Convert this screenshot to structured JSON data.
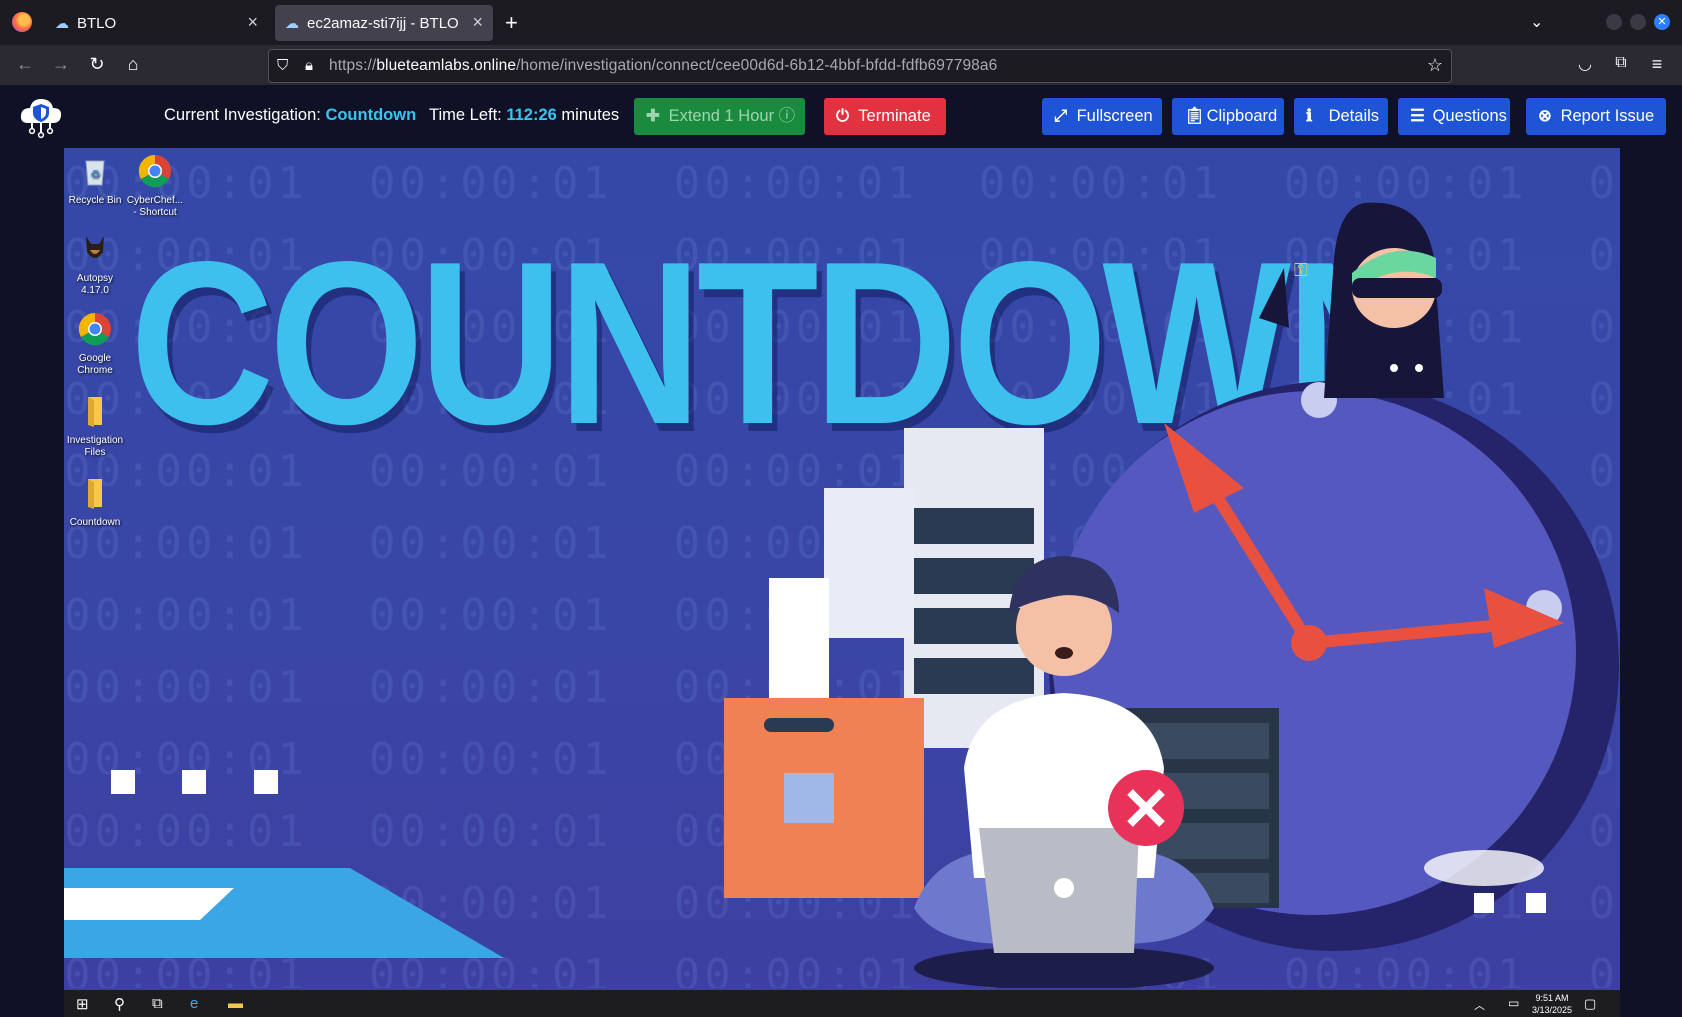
{
  "browser": {
    "tabs": [
      {
        "label": "BTLO",
        "active": false
      },
      {
        "label": "ec2amaz-sti7ijj - BTLO",
        "active": true
      }
    ],
    "url": {
      "scheme": "https://",
      "domain": "blueteamlabs.online",
      "path": "/home/investigation/connect/cee00d6d-6b12-4bbf-bfdd-fdfb697798a6"
    }
  },
  "header": {
    "investigation_label": "Current Investigation:",
    "investigation_name": "Countdown",
    "time_label": "Time Left:",
    "time_value": "112:26",
    "time_unit": "minutes",
    "buttons": {
      "extend": "Extend 1 Hour",
      "terminate": "Terminate",
      "fullscreen": "Fullscreen",
      "clipboard": "Clipboard",
      "details": "Details",
      "questions": "Questions",
      "report": "Report Issue"
    }
  },
  "desktop": {
    "wallpaper_title": "COUNTDOWN",
    "icons": [
      {
        "line1": "Recycle Bin",
        "line2": ""
      },
      {
        "line1": "CyberChef...",
        "line2": "- Shortcut"
      },
      {
        "line1": "Autopsy",
        "line2": "4.17.0"
      },
      {
        "line1": "Google",
        "line2": "Chrome"
      },
      {
        "line1": "Investigation",
        "line2": "Files"
      },
      {
        "line1": "Countdown",
        "line2": ""
      }
    ],
    "taskbar": {
      "time": "9:51 AM",
      "date": "3/13/2025"
    }
  },
  "colors": {
    "accent": "#39c4f0",
    "extend_green": "#198a3e",
    "terminate_red": "#e3323f",
    "button_blue": "#1d55d6",
    "header_bg": "#0f1226"
  }
}
